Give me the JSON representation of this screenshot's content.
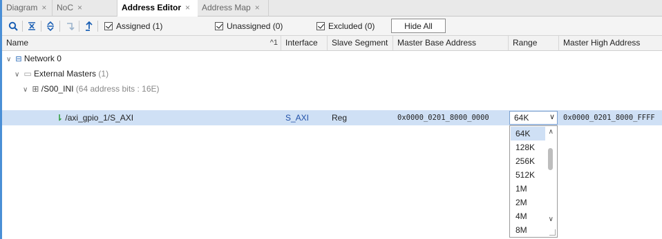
{
  "tabs": [
    {
      "label": "Diagram",
      "close": "×"
    },
    {
      "label": "NoC",
      "close": "×"
    },
    {
      "label": "Address Editor",
      "close": "×"
    },
    {
      "label": "Address Map",
      "close": "×"
    }
  ],
  "toolbar": {
    "icons": [
      "search-icon",
      "collapse-all-icon",
      "expand-all-icon",
      "unassign-icon",
      "auto-assign-icon"
    ],
    "checkboxes": [
      {
        "label": "Assigned (1)",
        "checked": true
      },
      {
        "label": "Unassigned (0)",
        "checked": true
      },
      {
        "label": "Excluded (0)",
        "checked": true
      }
    ],
    "hide_all": "Hide All"
  },
  "columns": {
    "name": "Name",
    "sort": "^1",
    "interface": "Interface",
    "slave_segment": "Slave Segment",
    "master_base": "Master Base Address",
    "range": "Range",
    "master_high": "Master High Address"
  },
  "tree": {
    "network": "Network 0",
    "ext_masters": "External Masters",
    "ext_masters_count": "(1)",
    "s00": "/S00_INI",
    "s00_info": "(64 address bits : 16E)",
    "gpio": {
      "name": "/axi_gpio_1/S_AXI",
      "interface": "S_AXI",
      "slave_segment": "Reg",
      "master_base": "0x0000_0201_8000_0000",
      "range": "64K",
      "master_high": "0x0000_0201_8000_FFFF"
    }
  },
  "range_options": [
    "64K",
    "128K",
    "256K",
    "512K",
    "1M",
    "2M",
    "4M",
    "8M"
  ],
  "range_selected": "64K",
  "colors": {
    "accent": "#4a8fd6",
    "selection": "#cfe0f5",
    "link": "#1f4fa8"
  }
}
